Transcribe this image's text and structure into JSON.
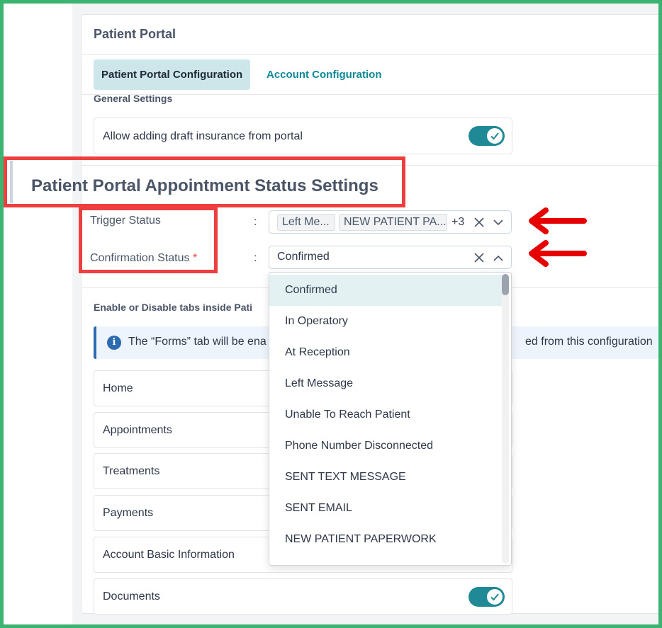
{
  "header": {
    "title": "Patient Portal"
  },
  "tabs": [
    {
      "label": "Patient Portal Configuration",
      "active": true
    },
    {
      "label": "Account Configuration",
      "active": false
    }
  ],
  "general_settings": {
    "heading": "General Settings",
    "items": [
      {
        "label": "Allow adding draft insurance from portal",
        "enabled": true
      }
    ]
  },
  "appointment_status": {
    "heading": "Patient Portal Appointment Status Settings",
    "trigger": {
      "label": "Trigger Status",
      "colon": ":",
      "chips": [
        "Left Me...",
        "NEW PATIENT PA..."
      ],
      "more": "+3"
    },
    "confirmation": {
      "label": "Confirmation Status",
      "required_mark": "*",
      "colon": ":",
      "value": "Confirmed"
    }
  },
  "tabs_section": {
    "heading": "Enable or Disable tabs inside Pati",
    "info_left": "The “Forms” tab will be ena",
    "info_right": "ed from this configuration",
    "items": [
      {
        "label": "Home"
      },
      {
        "label": "Appointments"
      },
      {
        "label": "Treatments"
      },
      {
        "label": "Payments"
      },
      {
        "label": "Account Basic Information"
      },
      {
        "label": "Documents",
        "enabled": true
      }
    ]
  },
  "dropdown": {
    "options": [
      "Confirmed",
      "In Operatory",
      "At Reception",
      "Left Message",
      "Unable To Reach Patient",
      "Phone Number Disconnected",
      "SENT TEXT MESSAGE",
      "SENT EMAIL",
      "NEW PATIENT PAPERWORK"
    ],
    "selected": "Confirmed"
  },
  "colors": {
    "accent": "#1f8a96",
    "highlight_red": "#ef3e3e",
    "frame_green": "#3cb371",
    "tab_active_bg": "#cde6ea"
  }
}
